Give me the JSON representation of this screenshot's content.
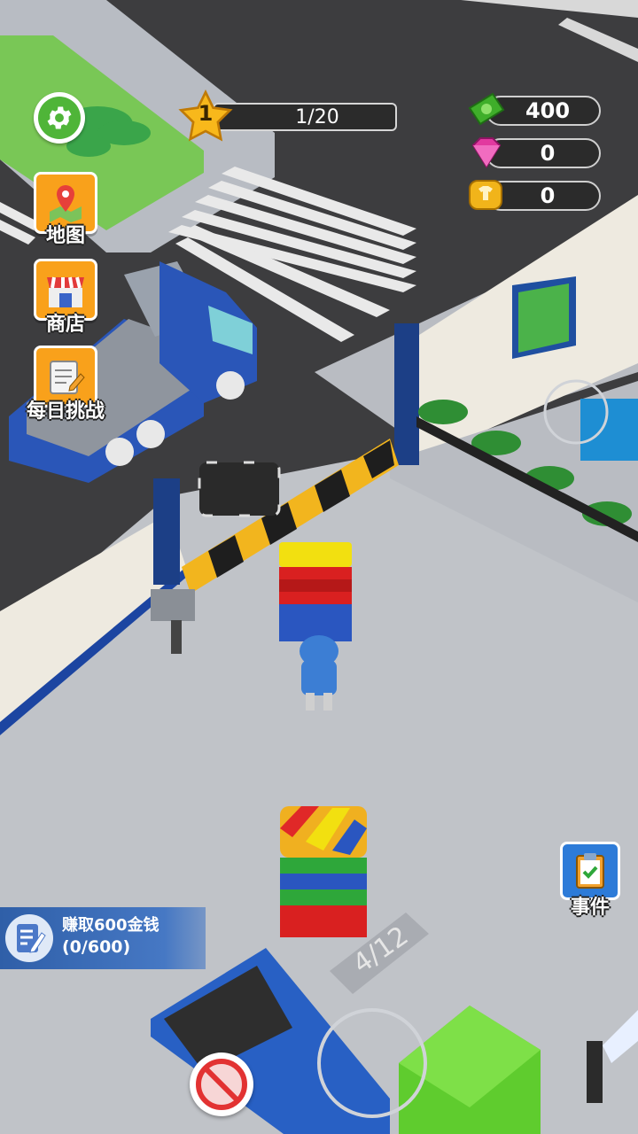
{
  "hud": {
    "level": "1",
    "progress_text": "1/20",
    "cash": "400",
    "gems": "0",
    "tokens": "0"
  },
  "side_menu": [
    {
      "label": "地图",
      "icon": "map-pin-icon"
    },
    {
      "label": "商店",
      "icon": "shop-icon"
    },
    {
      "label": "每日挑战",
      "icon": "daily-task-icon"
    }
  ],
  "events": {
    "label": "事件",
    "icon": "clipboard-check-icon"
  },
  "quest": {
    "title": "赚取600金钱",
    "progress": "(0/600)"
  },
  "stack_counter": "4/12",
  "colors": {
    "accent_orange": "#f9a11b",
    "settings_green": "#4fb538",
    "quest_blue": "#2f5fa8",
    "floor": "#b9bcc2",
    "road": "#3b3b3b"
  }
}
